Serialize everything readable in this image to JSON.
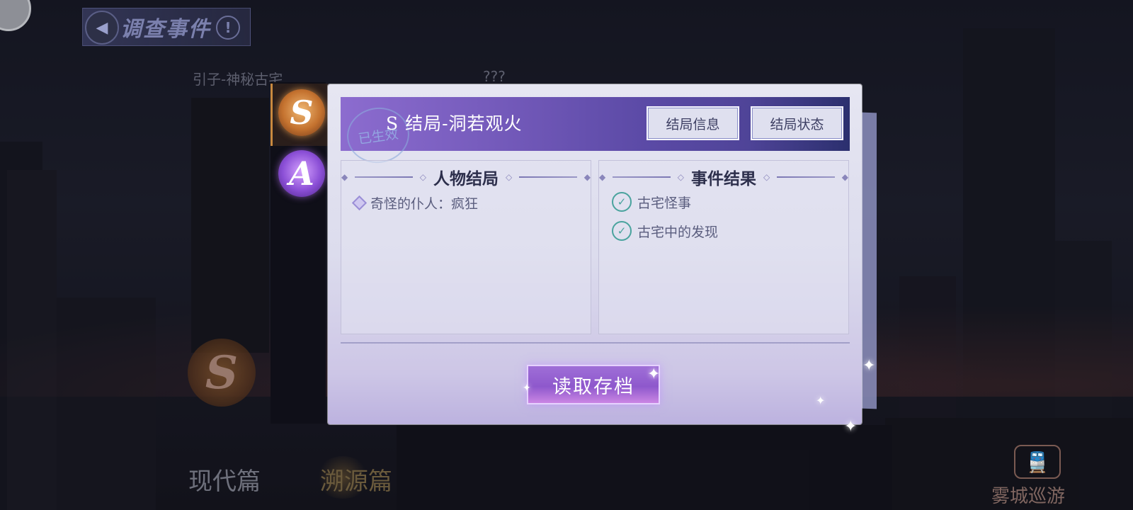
{
  "header": {
    "title": "调查事件",
    "back_icon": "arrow-left-icon",
    "alert_icon": "exclamation-icon",
    "alert_glyph": "!"
  },
  "background": {
    "chapter_label": "引子-神秘古宅",
    "unknown_label": "???",
    "medal_s": "S",
    "tabs": [
      "现代篇",
      "溯源篇"
    ],
    "tour_label": "雾城巡游"
  },
  "tiers": [
    {
      "letter": "S",
      "selected": true,
      "color": "#c4722f"
    },
    {
      "letter": "A",
      "selected": false,
      "color": "#8b4fd6"
    }
  ],
  "dialog": {
    "stamp": "已生效",
    "title": "S 结局-洞若观火",
    "buttons": {
      "info": "结局信息",
      "state": "结局状态"
    },
    "character_panel": {
      "title": "人物结局",
      "items": [
        "奇怪的仆人：疯狂"
      ]
    },
    "event_panel": {
      "title": "事件结果",
      "items": [
        "古宅怪事",
        "古宅中的发现"
      ]
    },
    "load_button": "读取存档"
  },
  "colors": {
    "accent_purple": "#8e58cc",
    "check_teal": "#4aa39e",
    "banner_start": "#8c6ccf",
    "banner_end": "#2b2f6e"
  }
}
